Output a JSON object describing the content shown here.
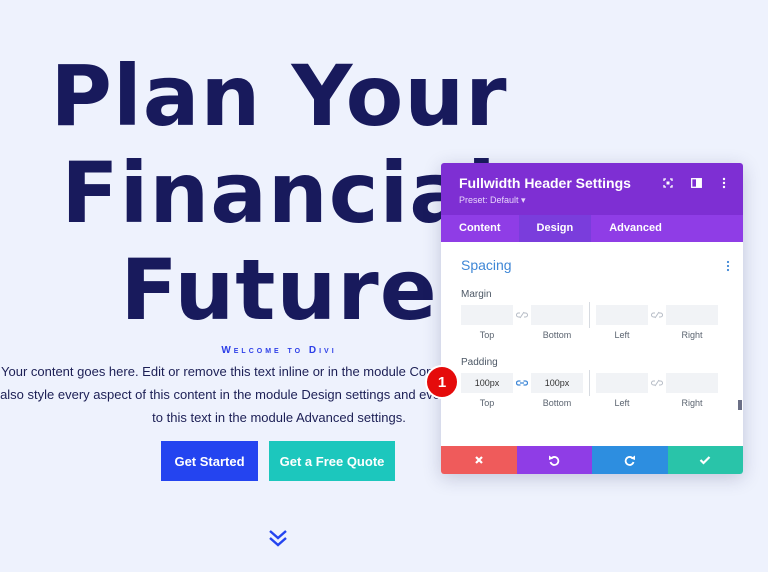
{
  "hero": {
    "title_lines": [
      "Plan Your",
      "Financial",
      "Future"
    ],
    "subheading": "Welcome to Divi",
    "body_lines": [
      "Your content goes here. Edit or remove this text inline or in the module Content settings. You can",
      "also style every aspect of this content in the module Design settings and even apply custom CSS",
      "to this text in the module Advanced settings."
    ],
    "primary_button": "Get Started",
    "secondary_button": "Get a Free Quote"
  },
  "panel": {
    "title": "Fullwidth Header Settings",
    "preset": "Preset: Default ▾",
    "tabs": [
      "Content",
      "Design",
      "Advanced"
    ],
    "active_tab": "Design",
    "section": "Spacing",
    "margin": {
      "label": "Margin",
      "fields": [
        {
          "label": "Top",
          "value": ""
        },
        {
          "label": "Bottom",
          "value": ""
        },
        {
          "label": "Left",
          "value": ""
        },
        {
          "label": "Right",
          "value": ""
        }
      ]
    },
    "padding": {
      "label": "Padding",
      "fields": [
        {
          "label": "Top",
          "value": "100px"
        },
        {
          "label": "Bottom",
          "value": "100px"
        },
        {
          "label": "Left",
          "value": ""
        },
        {
          "label": "Right",
          "value": ""
        }
      ]
    }
  },
  "callout_badge": "1",
  "colors": {
    "background": "#eef2fd",
    "heading": "#181a5c",
    "accent_blue": "#2444f0",
    "accent_teal": "#1cc7bd",
    "panel_purple": "#7e2fd3",
    "cancel_red": "#ef5b5b",
    "undo_purple": "#8f3de6",
    "redo_blue": "#2d8ee0",
    "save_green": "#29c4a9",
    "badge_red": "#e50b0b"
  }
}
